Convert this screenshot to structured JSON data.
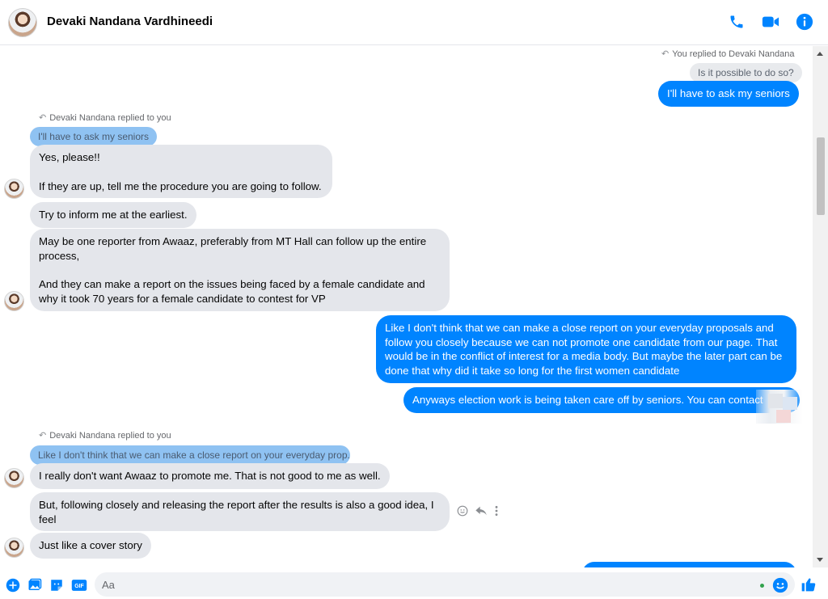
{
  "header": {
    "contact_name": "Devaki Nandana Vardhineedi",
    "icons": [
      "phone-icon",
      "video-camera-icon",
      "info-icon"
    ]
  },
  "accent_color": "#0084ff",
  "messages": {
    "reply_note_1": "You replied to Devaki Nandana",
    "quote_1": "Is it possible to do so?",
    "out_1": "I'll have to ask my seniors",
    "reply_note_2": "Devaki Nandana replied to you",
    "quote_2": "I'll have to ask my seniors",
    "in_1_line1": "Yes, please!!",
    "in_1_line2": "If they are up, tell me the procedure you are going to follow.",
    "in_2": "Try to inform me at the earliest.",
    "in_3_line1": "May be one reporter from Awaaz, preferably from MT Hall can follow up the entire process,",
    "in_3_line2": "And they can make a report on the issues being faced by a female candidate and why it took 70 years for a female candidate to contest for VP",
    "out_2": "Like I don't think that we can make a close report on your everyday proposals and follow you closely because we can not promote one candidate from our page. That would be in the conflict of interest for a media body. But maybe the later part can be done that why did it take so long for the first women candidate",
    "out_3": "Anyways election work is being taken care off by seniors. You can contact",
    "reply_note_3": "Devaki Nandana replied to you",
    "quote_3": "Like I don't think that we can make a close report on your everyday prop...",
    "in_4": "I really don't want Awaaz to promote me. That is not good to me as well.",
    "in_5": "But, following closely and releasing the report after the results is also a good idea, I feel",
    "in_6": "Just like a cover story"
  },
  "composer": {
    "placeholder": "Aa",
    "gif_label": "GIF",
    "icons": [
      "plus-icon",
      "photo-icon",
      "sticker-icon",
      "gif-icon",
      "emoji-icon",
      "thumbs-up-icon"
    ]
  }
}
